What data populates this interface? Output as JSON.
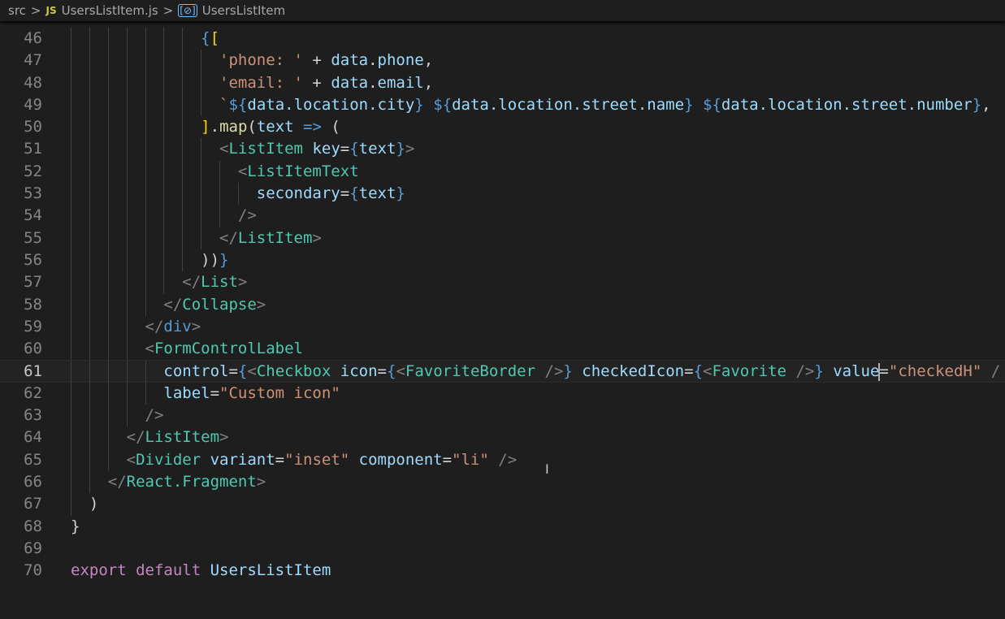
{
  "breadcrumb": {
    "folder": "src",
    "file_icon": "JS",
    "file": "UsersListItem.js",
    "symbol_icon": "symbol-variable-icon",
    "symbol": "UsersListItem",
    "separator": ">"
  },
  "current_line": 61,
  "colors": {
    "background": "#1e1e1e",
    "keyword": "#569cd6",
    "tag": "#4ec9b0",
    "attribute": "#9cdcfe",
    "string": "#ce9178"
  },
  "lines": [
    {
      "n": "46",
      "indent": 14,
      "tokens": [
        [
          "b",
          "{"
        ],
        [
          "y",
          "["
        ]
      ]
    },
    {
      "n": "47",
      "indent": 16,
      "tokens": [
        [
          "s",
          "'phone: '"
        ],
        [
          "x",
          " + "
        ],
        [
          "v",
          "data"
        ],
        [
          "x",
          "."
        ],
        [
          "v",
          "phone"
        ],
        [
          "x",
          ","
        ]
      ]
    },
    {
      "n": "48",
      "indent": 16,
      "tokens": [
        [
          "s",
          "'email: '"
        ],
        [
          "x",
          " + "
        ],
        [
          "v",
          "data"
        ],
        [
          "x",
          "."
        ],
        [
          "v",
          "email"
        ],
        [
          "x",
          ","
        ]
      ]
    },
    {
      "n": "49",
      "indent": 16,
      "tokens": [
        [
          "s",
          "`"
        ],
        [
          "k",
          "${"
        ],
        [
          "v",
          "data.location.city"
        ],
        [
          "k",
          "}"
        ],
        [
          "s",
          " "
        ],
        [
          "k",
          "${"
        ],
        [
          "v",
          "data.location.street.name"
        ],
        [
          "k",
          "}"
        ],
        [
          "s",
          " "
        ],
        [
          "k",
          "${"
        ],
        [
          "v",
          "data.location.street.number"
        ],
        [
          "k",
          "}"
        ],
        [
          "x",
          ","
        ]
      ]
    },
    {
      "n": "50",
      "indent": 14,
      "tokens": [
        [
          "y",
          "]"
        ],
        [
          "x",
          "."
        ],
        [
          "f",
          "map"
        ],
        [
          "x",
          "("
        ],
        [
          "v",
          "text"
        ],
        [
          "k",
          " => "
        ],
        [
          "x",
          "("
        ]
      ]
    },
    {
      "n": "51",
      "indent": 16,
      "tokens": [
        [
          "p",
          "<"
        ],
        [
          "t",
          "ListItem"
        ],
        [
          "a",
          " key"
        ],
        [
          "x",
          "="
        ],
        [
          "b",
          "{"
        ],
        [
          "v",
          "text"
        ],
        [
          "b",
          "}"
        ],
        [
          "p",
          ">"
        ]
      ]
    },
    {
      "n": "52",
      "indent": 18,
      "tokens": [
        [
          "p",
          "<"
        ],
        [
          "t",
          "ListItemText"
        ]
      ]
    },
    {
      "n": "53",
      "indent": 20,
      "tokens": [
        [
          "a",
          "secondary"
        ],
        [
          "x",
          "="
        ],
        [
          "b",
          "{"
        ],
        [
          "v",
          "text"
        ],
        [
          "b",
          "}"
        ]
      ]
    },
    {
      "n": "54",
      "indent": 18,
      "tokens": [
        [
          "p",
          "/>"
        ]
      ]
    },
    {
      "n": "55",
      "indent": 16,
      "tokens": [
        [
          "p",
          "</"
        ],
        [
          "t",
          "ListItem"
        ],
        [
          "p",
          ">"
        ]
      ]
    },
    {
      "n": "56",
      "indent": 14,
      "tokens": [
        [
          "x",
          "))"
        ],
        [
          "b",
          "}"
        ]
      ]
    },
    {
      "n": "57",
      "indent": 12,
      "tokens": [
        [
          "p",
          "</"
        ],
        [
          "t",
          "List"
        ],
        [
          "p",
          ">"
        ]
      ]
    },
    {
      "n": "58",
      "indent": 10,
      "tokens": [
        [
          "p",
          "</"
        ],
        [
          "t",
          "Collapse"
        ],
        [
          "p",
          ">"
        ]
      ]
    },
    {
      "n": "59",
      "indent": 8,
      "tokens": [
        [
          "p",
          "</"
        ],
        [
          "k",
          "div"
        ],
        [
          "p",
          ">"
        ]
      ]
    },
    {
      "n": "60",
      "indent": 8,
      "tokens": [
        [
          "p",
          "<"
        ],
        [
          "t",
          "FormControlLabel"
        ]
      ]
    },
    {
      "n": "61",
      "indent": 10,
      "tokens": [
        [
          "a",
          "control"
        ],
        [
          "x",
          "="
        ],
        [
          "b",
          "{"
        ],
        [
          "p",
          "<"
        ],
        [
          "t",
          "Checkbox"
        ],
        [
          "a",
          " icon"
        ],
        [
          "x",
          "="
        ],
        [
          "b",
          "{"
        ],
        [
          "p",
          "<"
        ],
        [
          "t",
          "FavoriteBorder"
        ],
        [
          "p",
          " />"
        ],
        [
          "b",
          "}"
        ],
        [
          "a",
          " checkedIcon"
        ],
        [
          "x",
          "="
        ],
        [
          "b",
          "{"
        ],
        [
          "p",
          "<"
        ],
        [
          "t",
          "Favorite"
        ],
        [
          "p",
          " />"
        ],
        [
          "b",
          "}"
        ],
        [
          "a",
          " value"
        ],
        [
          "cursor",
          ""
        ],
        [
          "x",
          "="
        ],
        [
          "s",
          "\"checkedH\""
        ],
        [
          "p",
          " /"
        ]
      ]
    },
    {
      "n": "62",
      "indent": 10,
      "tokens": [
        [
          "a",
          "label"
        ],
        [
          "x",
          "="
        ],
        [
          "s",
          "\"Custom icon\""
        ]
      ]
    },
    {
      "n": "63",
      "indent": 8,
      "tokens": [
        [
          "p",
          "/>"
        ]
      ]
    },
    {
      "n": "64",
      "indent": 6,
      "tokens": [
        [
          "p",
          "</"
        ],
        [
          "t",
          "ListItem"
        ],
        [
          "p",
          ">"
        ]
      ]
    },
    {
      "n": "65",
      "indent": 6,
      "tokens": [
        [
          "p",
          "<"
        ],
        [
          "t",
          "Divider"
        ],
        [
          "a",
          " variant"
        ],
        [
          "x",
          "="
        ],
        [
          "s",
          "\"inset\""
        ],
        [
          "a",
          " component"
        ],
        [
          "x",
          "="
        ],
        [
          "s",
          "\"li\""
        ],
        [
          "p",
          " />"
        ]
      ]
    },
    {
      "n": "66",
      "indent": 4,
      "tokens": [
        [
          "p",
          "</"
        ],
        [
          "t",
          "React.Fragment"
        ],
        [
          "p",
          ">"
        ]
      ]
    },
    {
      "n": "67",
      "indent": 2,
      "tokens": [
        [
          "x",
          ")"
        ]
      ]
    },
    {
      "n": "68",
      "indent": 0,
      "tokens": [
        [
          "x",
          "}"
        ]
      ]
    },
    {
      "n": "69",
      "indent": 0,
      "tokens": []
    },
    {
      "n": "70",
      "indent": 0,
      "tokens": [
        [
          "c",
          "export"
        ],
        [
          "c",
          " default"
        ],
        [
          "v",
          " UsersListItem"
        ]
      ]
    }
  ]
}
